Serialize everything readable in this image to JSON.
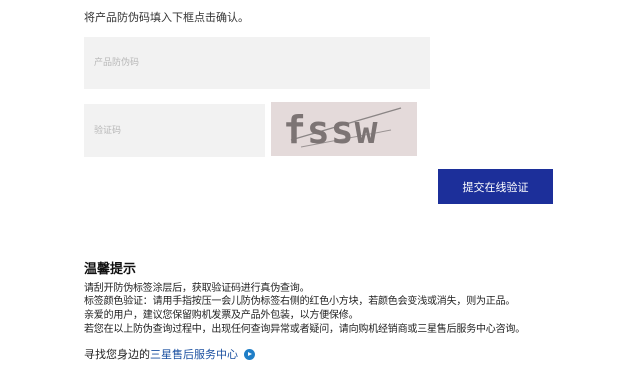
{
  "instruction": "将产品防伪码填入下框点击确认。",
  "form": {
    "code_placeholder": "产品防伪码",
    "captcha_placeholder": "验证码",
    "captcha_text": "fssw",
    "submit_label": "提交在线验证"
  },
  "tips": {
    "title": "温馨提示",
    "lines": [
      "请刮开防伪标签涂层后，获取验证码进行真伪查询。",
      "标签颜色验证：请用手指按压一会儿防伪标签右侧的红色小方块，若颜色会变浅或消失，则为正品。",
      "亲爱的用户，建议您保留购机发票及产品外包装，以方便保修。",
      "若您在以上防伪查询过程中，出现任何查询异常或者疑问，请向购机经销商或三星售后服务中心咨询。"
    ]
  },
  "footer": {
    "prefix": "寻找您身边的",
    "link": "三星售后服务中心",
    "icon": "arrow-circle-icon"
  },
  "colors": {
    "button": "#1c2f9a",
    "link": "#1a4fa0",
    "field_bg": "#f2f2f2"
  }
}
